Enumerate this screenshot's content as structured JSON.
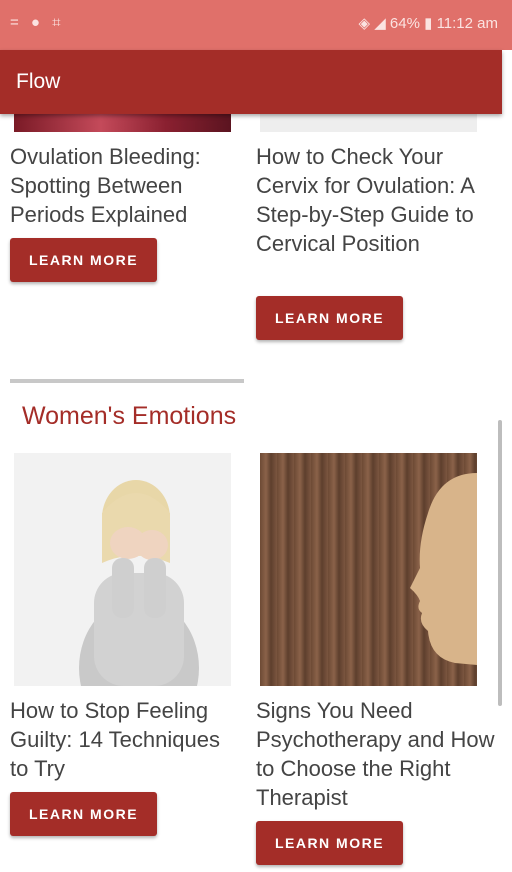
{
  "status_bar": {
    "left_icons": "= ● ⌗",
    "battery": "64%",
    "time": "11:12 am"
  },
  "app_bar": {
    "title": "Flow"
  },
  "articles_top": [
    {
      "title": "Ovulation Bleeding: Spotting Between Periods Explained",
      "button": "LEARN MORE"
    },
    {
      "title": "How to Check Your Cervix for Ovulation: A Step-by-Step Guide to Cervical Position",
      "button": "LEARN MORE"
    }
  ],
  "section": {
    "title": "Women's Emotions"
  },
  "articles_bottom": [
    {
      "title": "How to Stop Feeling Guilty: 14 Techniques to Try",
      "button": "LEARN MORE"
    },
    {
      "title": "Signs You Need Psychotherapy and How to Choose the Right Therapist",
      "button": "LEARN MORE"
    }
  ],
  "colors": {
    "primary": "#a42d28",
    "status_bar": "#e0706a",
    "text": "#444444"
  }
}
